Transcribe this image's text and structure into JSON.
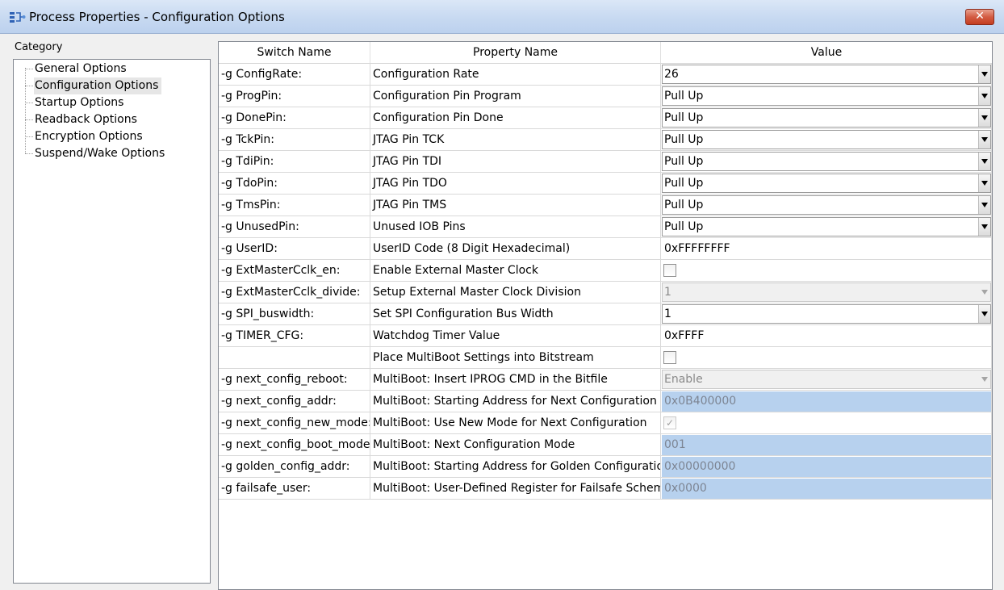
{
  "window": {
    "title": "Process Properties - Configuration Options",
    "close_glyph": "✕"
  },
  "category": {
    "label": "Category",
    "items": [
      {
        "label": "General Options"
      },
      {
        "label": "Configuration Options",
        "selected": true
      },
      {
        "label": "Startup Options"
      },
      {
        "label": "Readback Options"
      },
      {
        "label": "Encryption Options"
      },
      {
        "label": "Suspend/Wake Options"
      }
    ]
  },
  "grid": {
    "headers": [
      "Switch Name",
      "Property Name",
      "Value"
    ],
    "rows": [
      {
        "switch": "-g ConfigRate:",
        "property": "Configuration Rate",
        "type": "combo",
        "value": "26"
      },
      {
        "switch": "-g ProgPin:",
        "property": "Configuration Pin Program",
        "type": "combo",
        "value": "Pull Up"
      },
      {
        "switch": "-g DonePin:",
        "property": "Configuration Pin Done",
        "type": "combo",
        "value": "Pull Up"
      },
      {
        "switch": "-g TckPin:",
        "property": "JTAG Pin TCK",
        "type": "combo",
        "value": "Pull Up"
      },
      {
        "switch": "-g TdiPin:",
        "property": "JTAG Pin TDI",
        "type": "combo",
        "value": "Pull Up"
      },
      {
        "switch": "-g TdoPin:",
        "property": "JTAG Pin TDO",
        "type": "combo",
        "value": "Pull Up"
      },
      {
        "switch": "-g TmsPin:",
        "property": "JTAG Pin TMS",
        "type": "combo",
        "value": "Pull Up"
      },
      {
        "switch": "-g UnusedPin:",
        "property": "Unused IOB Pins",
        "type": "combo",
        "value": "Pull Up"
      },
      {
        "switch": "-g UserID:",
        "property": "UserID Code (8 Digit Hexadecimal)",
        "type": "text",
        "value": "0xFFFFFFFF"
      },
      {
        "switch": "-g ExtMasterCclk_en:",
        "property": "Enable External Master Clock",
        "type": "checkbox",
        "value": ""
      },
      {
        "switch": "-g ExtMasterCclk_divide:",
        "property": "Setup External Master Clock Division",
        "type": "combo-disabled",
        "value": "1"
      },
      {
        "switch": "-g SPI_buswidth:",
        "property": "Set SPI Configuration Bus Width",
        "type": "combo",
        "value": "1"
      },
      {
        "switch": "-g TIMER_CFG:",
        "property": "Watchdog Timer Value",
        "type": "text",
        "value": "0xFFFF"
      },
      {
        "switch": "",
        "property": "Place MultiBoot Settings into Bitstream",
        "type": "checkbox",
        "value": ""
      },
      {
        "switch": "-g next_config_reboot:",
        "property": "MultiBoot: Insert IPROG CMD in the Bitfile",
        "type": "combo-disabled",
        "value": "Enable"
      },
      {
        "switch": "-g next_config_addr:",
        "property": "MultiBoot: Starting Address for Next Configuration",
        "type": "highlight",
        "value": "0x0B400000"
      },
      {
        "switch": "-g next_config_new_mode:",
        "property": "MultiBoot: Use New Mode for Next Configuration",
        "type": "checkbox-checked-disabled",
        "value": "✓"
      },
      {
        "switch": "-g next_config_boot_mode:",
        "property": "MultiBoot: Next Configuration Mode",
        "type": "highlight",
        "value": "001"
      },
      {
        "switch": "-g golden_config_addr:",
        "property": "MultiBoot: Starting Address for Golden Configuration",
        "type": "highlight",
        "value": "0x00000000"
      },
      {
        "switch": "-g failsafe_user:",
        "property": "MultiBoot: User-Defined Register for Failsafe Scheme",
        "type": "highlight",
        "value": "0x0000"
      }
    ]
  }
}
